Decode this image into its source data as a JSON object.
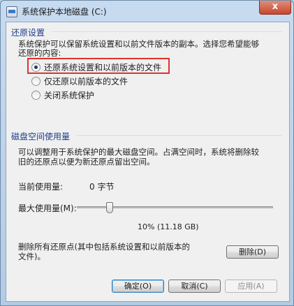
{
  "window": {
    "title": "系统保护本地磁盘 (C:)",
    "close_glyph": "x"
  },
  "restore": {
    "group_title": "还原设置",
    "description_line1": "系统保护可以保留系统设置和以前文件版本的副本。选择您希望能够",
    "description_line2": "还原的内容:",
    "options": [
      {
        "label": "还原系统设置和以前版本的文件",
        "checked": true
      },
      {
        "label": "仅还原以前版本的文件",
        "checked": false
      },
      {
        "label": "关闭系统保护",
        "checked": false
      }
    ]
  },
  "disk": {
    "group_title": "磁盘空间使用量",
    "description_line1": "可以调整用于系统保护的最大磁盘空间。占满空间时，系统将删除较",
    "description_line2": "旧的还原点以便为新还原点留出空间。",
    "current_usage_label": "当前使用量:",
    "current_usage_value": "0 字节",
    "max_usage_label": "最大使用量(M):",
    "slider_percent": 10,
    "slider_value_text": "10% (11.18 GB)",
    "delete_text_line1": "删除所有还原点(其中包括系统设置和以前版本的",
    "delete_text_line2": "文件)。",
    "delete_button": "删除(D)"
  },
  "buttons": {
    "ok": "确定(O)",
    "cancel": "取消(C)",
    "apply": "应用(A)"
  }
}
